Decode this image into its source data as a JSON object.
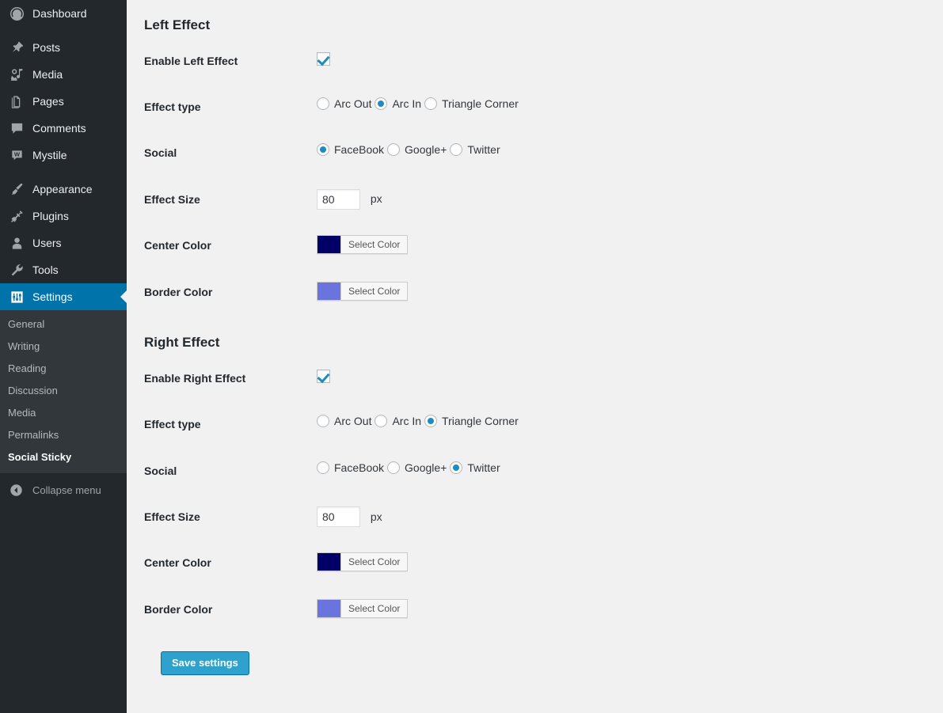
{
  "sidebar": {
    "items": [
      {
        "label": "Dashboard",
        "icon": "dashboard-icon",
        "name": "dashboard"
      },
      {
        "label": "Posts",
        "icon": "pin-icon",
        "name": "posts"
      },
      {
        "label": "Media",
        "icon": "media-icon",
        "name": "media"
      },
      {
        "label": "Pages",
        "icon": "pages-icon",
        "name": "pages"
      },
      {
        "label": "Comments",
        "icon": "comment-bubble-icon",
        "name": "comments"
      },
      {
        "label": "Mystile",
        "icon": "mystile-icon",
        "name": "mystile"
      },
      {
        "label": "Appearance",
        "icon": "paintbrush-icon",
        "name": "appearance"
      },
      {
        "label": "Plugins",
        "icon": "plug-icon",
        "name": "plugins"
      },
      {
        "label": "Users",
        "icon": "user-icon",
        "name": "users"
      },
      {
        "label": "Tools",
        "icon": "wrench-icon",
        "name": "tools"
      },
      {
        "label": "Settings",
        "icon": "settings-sliders-icon",
        "name": "settings",
        "current": true
      }
    ],
    "submenu": [
      {
        "label": "General",
        "name": "general"
      },
      {
        "label": "Writing",
        "name": "writing"
      },
      {
        "label": "Reading",
        "name": "reading"
      },
      {
        "label": "Discussion",
        "name": "discussion"
      },
      {
        "label": "Media",
        "name": "media"
      },
      {
        "label": "Permalinks",
        "name": "permalinks"
      },
      {
        "label": "Social Sticky",
        "name": "social-sticky",
        "current": true
      }
    ],
    "collapse_label": "Collapse menu",
    "collapse_icon": "chevron-left-circle-icon",
    "accent": "#0073aa",
    "bg": "#23282d",
    "submenu_bg": "#32373c"
  },
  "main": {
    "left_section": {
      "title": "Left Effect",
      "enable": {
        "label": "Enable Left Effect",
        "checked": true
      },
      "effect_type": {
        "label": "Effect type",
        "options": [
          "Arc Out",
          "Arc In",
          "Triangle Corner"
        ],
        "selected": "Arc In"
      },
      "social": {
        "label": "Social",
        "options": [
          "FaceBook",
          "Google+",
          "Twitter"
        ],
        "selected": "FaceBook"
      },
      "effect_size": {
        "label": "Effect Size",
        "value": "80",
        "unit": "px"
      },
      "center_color": {
        "label": "Center Color",
        "button_label": "Select Color",
        "value": "#000066"
      },
      "border_color": {
        "label": "Border Color",
        "button_label": "Select Color",
        "value": "#6b74dd"
      }
    },
    "right_section": {
      "title": "Right Effect",
      "enable": {
        "label": "Enable Right Effect",
        "checked": true
      },
      "effect_type": {
        "label": "Effect type",
        "options": [
          "Arc Out",
          "Arc In",
          "Triangle Corner"
        ],
        "selected": "Triangle Corner"
      },
      "social": {
        "label": "Social",
        "options": [
          "FaceBook",
          "Google+",
          "Twitter"
        ],
        "selected": "Twitter"
      },
      "effect_size": {
        "label": "Effect Size",
        "value": "80",
        "unit": "px"
      },
      "center_color": {
        "label": "Center Color",
        "button_label": "Select Color",
        "value": "#000066"
      },
      "border_color": {
        "label": "Border Color",
        "button_label": "Select Color",
        "value": "#6b74dd"
      }
    },
    "save_button": {
      "label": "Save settings",
      "color": "#2ea2cc",
      "border_color": "#0074a2"
    }
  }
}
